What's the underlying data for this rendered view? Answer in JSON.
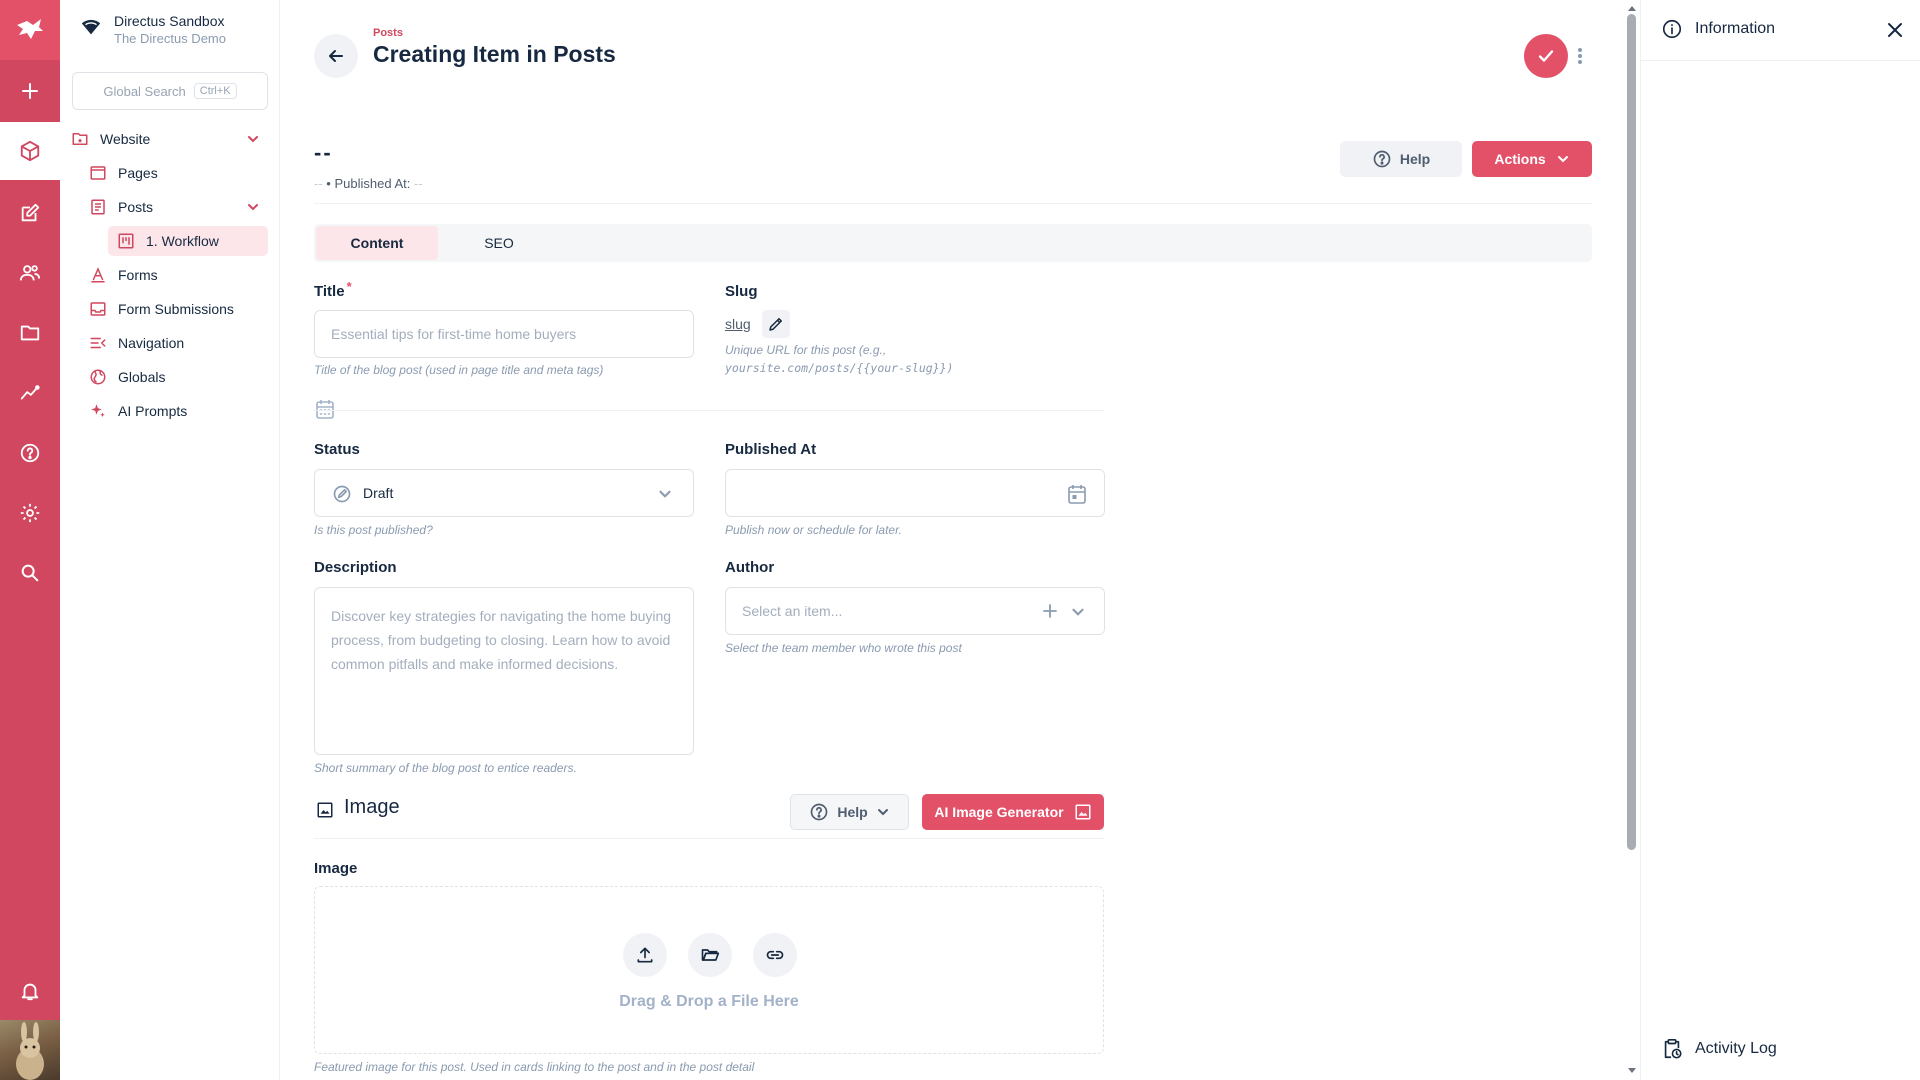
{
  "project": {
    "name": "Directus Sandbox",
    "description": "The Directus Demo"
  },
  "search": {
    "label": "Global Search",
    "shortcut": "Ctrl+K"
  },
  "nav": {
    "website": "Website",
    "pages": "Pages",
    "posts": "Posts",
    "workflow": "1. Workflow",
    "forms": "Forms",
    "form_submissions": "Form Submissions",
    "navigation": "Navigation",
    "globals": "Globals",
    "ai_prompts": "AI Prompts"
  },
  "header": {
    "breadcrumb": "Posts",
    "title": "Creating Item in Posts"
  },
  "item": {
    "title": "--",
    "meta_prefix": "--",
    "meta_label": "• Published At:",
    "meta_value": "--"
  },
  "buttons": {
    "help": "Help",
    "actions": "Actions",
    "ai_image": "AI Image Generator"
  },
  "tabs": [
    "Content",
    "SEO"
  ],
  "fields": {
    "title": {
      "label": "Title",
      "required": "*",
      "placeholder": "Essential tips for first-time home buyers",
      "note": "Title of the blog post (used in page title and meta tags)"
    },
    "slug": {
      "label": "Slug",
      "value": "slug",
      "note_line1": "Unique URL for this post (e.g.,",
      "note_line2": "yoursite.com/posts/{{your-slug}})"
    },
    "status": {
      "label": "Status",
      "value": "Draft",
      "note": "Is this post published?"
    },
    "published_at": {
      "label": "Published At",
      "note": "Publish now or schedule for later."
    },
    "description": {
      "label": "Description",
      "placeholder": "Discover key strategies for navigating the home buying process, from budgeting to closing. Learn how to avoid common pitfalls and make informed decisions.",
      "note": "Short summary of the blog post to entice readers."
    },
    "author": {
      "label": "Author",
      "placeholder": "Select an item...",
      "note": "Select the team member who wrote this post"
    },
    "image_section": {
      "title": "Image"
    },
    "image": {
      "label": "Image",
      "dropzone_text": "Drag & Drop a File Here",
      "note": "Featured image for this post. Used in cards linking to the post and in the post detail"
    }
  },
  "sidebar": {
    "information": "Information",
    "activity_log": "Activity Log"
  },
  "colors": {
    "brand": "#e35169",
    "brand_dark": "#d1475f",
    "text": "#172940",
    "muted": "#8a9bb0"
  }
}
